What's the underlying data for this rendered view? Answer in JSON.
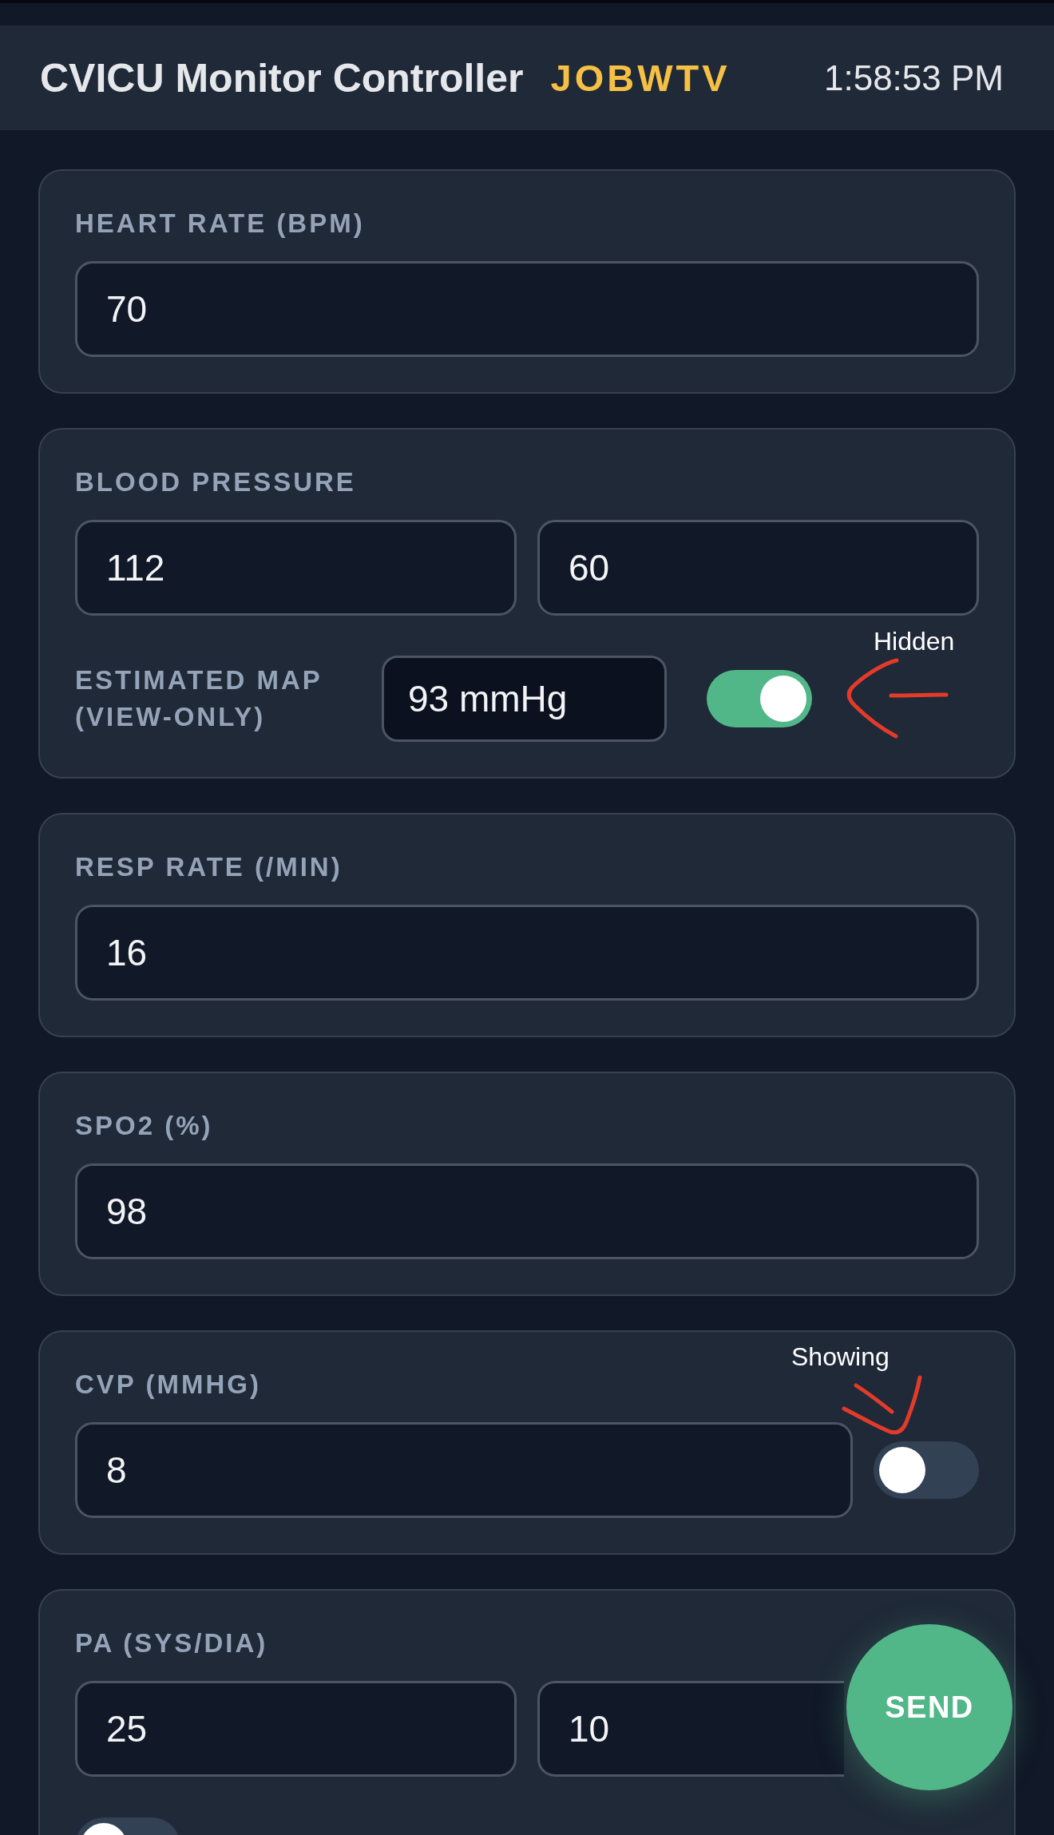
{
  "header": {
    "title": "CVICU Monitor Controller",
    "code": "JOBWTV",
    "time": "1:58:53 PM"
  },
  "cards": [
    {
      "kind": "single",
      "label": "HEART RATE (BPM)",
      "fields": [
        {
          "value": "70"
        }
      ]
    },
    {
      "kind": "pair",
      "label": "BLOOD PRESSURE",
      "fields": [
        {
          "value": "112"
        },
        {
          "value": "60"
        }
      ],
      "map": {
        "label": "ESTIMATED MAP (VIEW-ONLY)",
        "value": "93 mmHg",
        "toggle": {
          "on": true
        }
      },
      "annotation": {
        "kind": "arrow",
        "text": "Hidden"
      }
    },
    {
      "kind": "single",
      "label": "RESP RATE (/MIN)",
      "fields": [
        {
          "value": "16"
        }
      ]
    },
    {
      "kind": "single",
      "label": "SPO2 (%)",
      "fields": [
        {
          "value": "98"
        }
      ]
    },
    {
      "kind": "single",
      "label": "CVP (MMHG)",
      "fields": [
        {
          "value": "8"
        }
      ],
      "toggle": {
        "on": false
      },
      "annotation": {
        "kind": "check",
        "text": "Showing"
      }
    },
    {
      "kind": "pair",
      "label": "PA (SYS/DIA)",
      "fields": [
        {
          "value": "25"
        },
        {
          "value": "10"
        }
      ],
      "toggle": {
        "on": false
      }
    }
  ],
  "send_button": {
    "label": "SEND"
  }
}
